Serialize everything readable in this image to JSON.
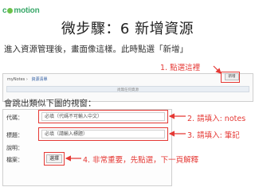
{
  "logo": {
    "prefix": "c",
    "suffix": "motion"
  },
  "slide": {
    "title": "微步驟：6 新增資源",
    "intro": "進入資源管理後，畫面像這樣。此時點選「新增」",
    "popup_intro": "會跳出類似下圖的視窗："
  },
  "screenshot1": {
    "crumb_root": "myNotes",
    "crumb_page": "資源清單",
    "bar_text": "尚無任何資源",
    "add_button": "新增"
  },
  "screenshot2": {
    "rows": [
      {
        "label": "代碼：",
        "value": "必填（代碼不可輸入中文）"
      },
      {
        "label": "標題：",
        "value": "必填（請輸入標題）"
      },
      {
        "label": "說明：",
        "value": ""
      },
      {
        "label": "檔案：",
        "value": ""
      }
    ],
    "select_button": "選擇"
  },
  "annotations": {
    "step1": "1. 點選這裡",
    "step2": "2. 請填入: notes",
    "step3": "3. 請填入: 筆記",
    "step4": "4. 非常重要，先點選，下一頁解釋"
  },
  "colors": {
    "annotation": "#e53935",
    "brand": "#3aa86a"
  }
}
